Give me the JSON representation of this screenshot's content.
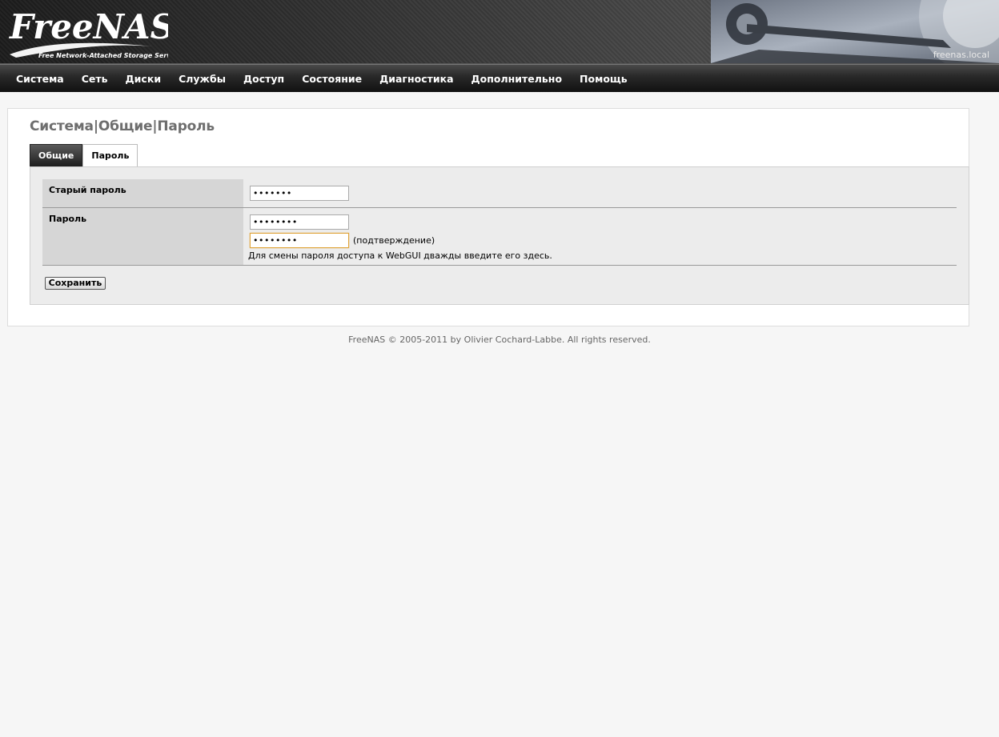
{
  "header": {
    "logo_text": "FreeNAS",
    "logo_subtitle": "Free Network-Attached Storage Server",
    "hostname": "freenas.local"
  },
  "nav": {
    "items": [
      "Система",
      "Сеть",
      "Диски",
      "Службы",
      "Доступ",
      "Состояние",
      "Диагностика",
      "Дополнительно",
      "Помощь"
    ]
  },
  "page": {
    "breadcrumb": "Система|Общие|Пароль",
    "tabs": [
      {
        "label": "Общие",
        "active": true
      },
      {
        "label": "Пароль",
        "active": false
      }
    ]
  },
  "form": {
    "old_password_label": "Старый пароль",
    "old_password_value": "•••••••",
    "password_label": "Пароль",
    "password_value": "••••••••",
    "confirm_value": "••••••••",
    "confirm_hint": "(подтверждение)",
    "help_text": "Для смены пароля доступа к WebGUI дважды введите его здесь.",
    "save_label": "Сохранить"
  },
  "footer": {
    "copyright": "FreeNAS © 2005-2011 by Olivier Cochard-Labbe. All rights reserved."
  }
}
